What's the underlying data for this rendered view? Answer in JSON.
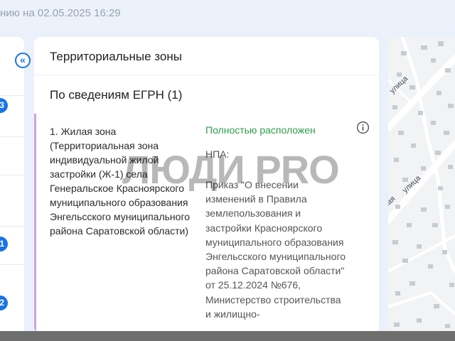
{
  "header": {
    "updated_text": "нию на 02.05.2025 16:29"
  },
  "left_panel": {
    "collapse_icon": "«",
    "badges": [
      "3",
      "1",
      "2"
    ]
  },
  "card": {
    "title": "Территориальные зоны",
    "section_title": "По сведениям ЕГРН (1)",
    "item": {
      "name": "1. Жилая зона (Территориальная зона индивидуальной жилой застройки (Ж-1) села Генеральское Красноярского муниципального образования Энгельсского муниципального района Саратовской области)",
      "status": "Полностью расположен",
      "npa_label": "НПА:",
      "npa_text": "Приказ \"О внесении изменений в Правила землепользования и застройки Красноярского муниципального образования Энгельсского муниципального района Саратовской области\" от 25.12.2024 №676, Министерство строительства и жилищно-"
    }
  },
  "watermark": "ЛЮДИ PRO",
  "map": {
    "street_1": "улица",
    "street_2": "улица",
    "street_3": "кая"
  },
  "colors": {
    "accent": "#1a73e8",
    "status_green": "#2e9d4a",
    "item_bar": "#c9a6de"
  }
}
